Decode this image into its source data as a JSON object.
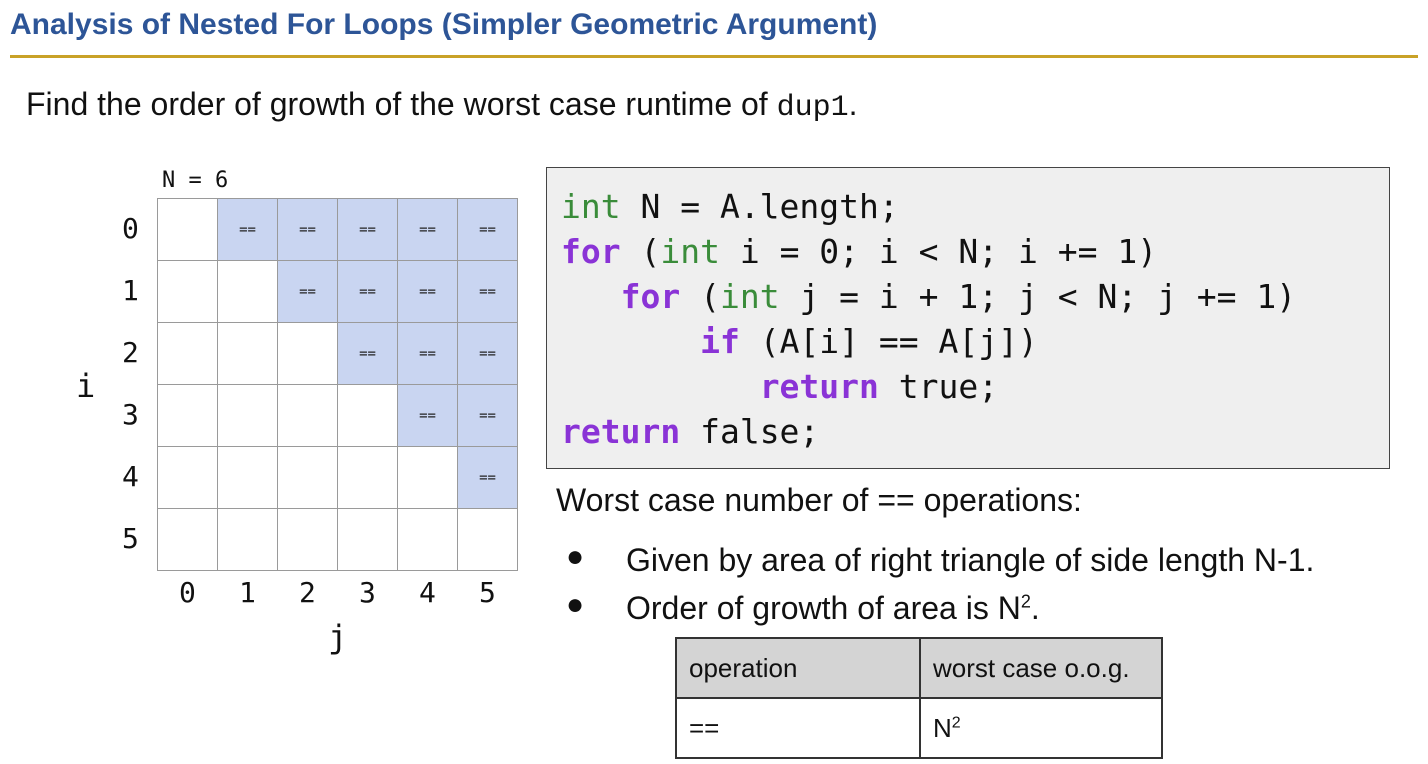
{
  "slide": {
    "title": "Analysis of Nested For Loops (Simpler Geometric Argument)",
    "question_prefix": "Find the order of growth of the worst case runtime of ",
    "question_code": "dup1",
    "question_suffix": "."
  },
  "grid": {
    "n_label": "N = 6",
    "size": 6,
    "cell_symbol": "==",
    "row_labels": [
      "0",
      "1",
      "2",
      "3",
      "4",
      "5"
    ],
    "col_labels": [
      "0",
      "1",
      "2",
      "3",
      "4",
      "5"
    ],
    "row_axis_label": "i",
    "col_axis_label": "j",
    "highlight_color": "#c9d5f1"
  },
  "code": {
    "lines": [
      [
        {
          "t": "int",
          "c": "type"
        },
        {
          "t": " N = A.length;"
        }
      ],
      [
        {
          "t": "for",
          "c": "ctrl"
        },
        {
          "t": " ("
        },
        {
          "t": "int",
          "c": "type"
        },
        {
          "t": " i = 0; i < N; i += 1)"
        }
      ],
      [
        {
          "t": "   "
        },
        {
          "t": "for",
          "c": "ctrl"
        },
        {
          "t": " ("
        },
        {
          "t": "int",
          "c": "type"
        },
        {
          "t": " j = i + 1; j < N; j += 1)"
        }
      ],
      [
        {
          "t": "       "
        },
        {
          "t": "if",
          "c": "ctrl"
        },
        {
          "t": " (A[i] == A[j])"
        }
      ],
      [
        {
          "t": "          "
        },
        {
          "t": "return",
          "c": "ctrl"
        },
        {
          "t": " true;"
        }
      ],
      [
        {
          "t": "return",
          "c": "ctrl"
        },
        {
          "t": " false;"
        }
      ]
    ]
  },
  "worst_case": {
    "heading": "Worst case number of == operations:",
    "bullet_symbol": "●",
    "bullet1": "Given by area of right triangle of side length N-1.",
    "bullet2_prefix": "Order of growth of area is N",
    "bullet2_sup": "2",
    "bullet2_suffix": "."
  },
  "table": {
    "header_operation": "operation",
    "header_oog": "worst case o.o.g.",
    "row_operation": "==",
    "row_oog_base": "N",
    "row_oog_sup": "2"
  },
  "colors": {
    "title": "#2d5597",
    "title_rule": "#c9a227",
    "code_type_keyword": "#3a8c3a",
    "code_control_keyword": "#8a33d6",
    "code_background": "#efefef"
  }
}
